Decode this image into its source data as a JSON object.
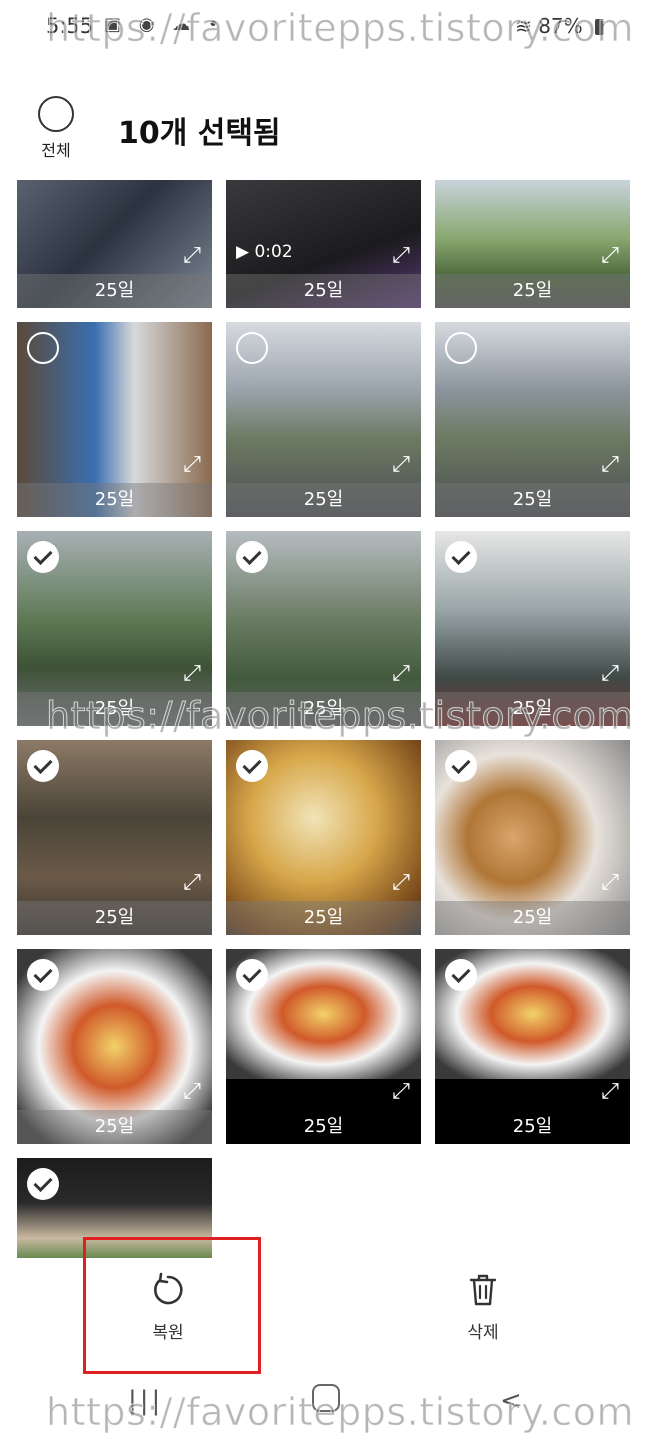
{
  "status_bar": {
    "time": "5:55",
    "battery": "87%"
  },
  "header": {
    "select_all_label": "전체",
    "title": "10개 선택됨"
  },
  "photos": [
    {
      "date": "25일",
      "selected": false,
      "checkbox": "none",
      "video_duration": ""
    },
    {
      "date": "25일",
      "selected": false,
      "checkbox": "none",
      "video_duration": "0:02"
    },
    {
      "date": "25일",
      "selected": false,
      "checkbox": "none",
      "video_duration": ""
    },
    {
      "date": "25일",
      "selected": false,
      "checkbox": "empty",
      "video_duration": ""
    },
    {
      "date": "25일",
      "selected": false,
      "checkbox": "empty",
      "video_duration": ""
    },
    {
      "date": "25일",
      "selected": false,
      "checkbox": "empty",
      "video_duration": ""
    },
    {
      "date": "25일",
      "selected": true,
      "checkbox": "checked",
      "video_duration": ""
    },
    {
      "date": "25일",
      "selected": true,
      "checkbox": "checked",
      "video_duration": ""
    },
    {
      "date": "25일",
      "selected": true,
      "checkbox": "checked",
      "video_duration": ""
    },
    {
      "date": "25일",
      "selected": true,
      "checkbox": "checked",
      "video_duration": ""
    },
    {
      "date": "25일",
      "selected": true,
      "checkbox": "checked",
      "video_duration": ""
    },
    {
      "date": "25일",
      "selected": true,
      "checkbox": "checked",
      "video_duration": ""
    },
    {
      "date": "25일",
      "selected": true,
      "checkbox": "checked",
      "video_duration": ""
    },
    {
      "date": "25일",
      "selected": true,
      "checkbox": "checked",
      "video_duration": ""
    },
    {
      "date": "25일",
      "selected": true,
      "checkbox": "checked",
      "video_duration": ""
    },
    {
      "date": "",
      "selected": true,
      "checkbox": "checked",
      "video_duration": ""
    }
  ],
  "actions": {
    "restore_label": "복원",
    "delete_label": "삭제"
  },
  "watermark": "https://favoritepps.tistory.com",
  "colors": {
    "highlight": "#e02020",
    "background": "#ffffff"
  }
}
